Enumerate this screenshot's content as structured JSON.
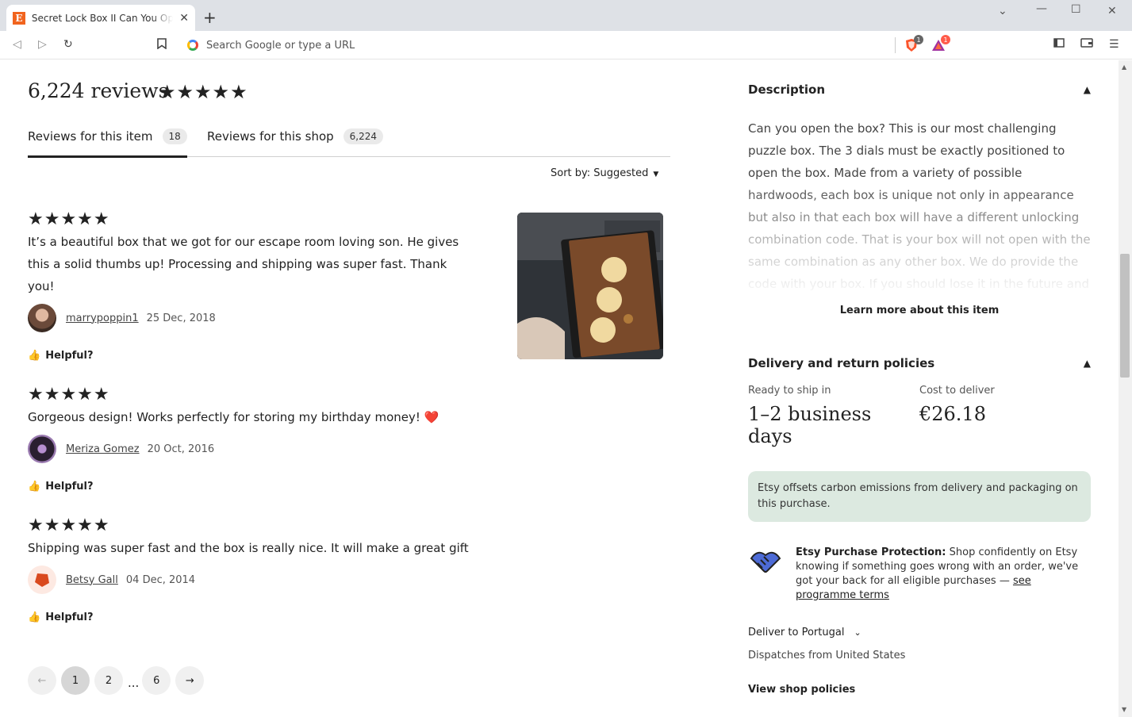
{
  "browser": {
    "tab_title": "Secret Lock Box II Can You Open the Box?",
    "tab_favicon": "E",
    "new_tab": "+",
    "omnibox_placeholder": "Search Google or type a URL",
    "ext_brave_badge": "1",
    "ext_rewards_badge": "1"
  },
  "reviews": {
    "heading": "6,224 reviews",
    "heading_stars": "★★★★★",
    "tabs": [
      {
        "label": "Reviews for this item",
        "count": "18"
      },
      {
        "label": "Reviews for this shop",
        "count": "6,224"
      }
    ],
    "sort_label": "Sort by: Suggested",
    "helpful_label": "Helpful?",
    "items": [
      {
        "stars": "★★★★★",
        "text": "It’s a beautiful box that we got for our escape room loving son. He gives this a solid thumbs up! Processing and shipping was super fast. Thank you!",
        "reviewer": "marrypoppin1",
        "date": "25 Dec, 2018"
      },
      {
        "stars": "★★★★★",
        "text": "Gorgeous design! Works perfectly for storing my birthday money! ❤️",
        "reviewer": "Meriza Gomez",
        "date": "20 Oct, 2016"
      },
      {
        "stars": "★★★★★",
        "text": "Shipping was super fast and the box is really nice. It will make a great gift",
        "reviewer": "Betsy Gall",
        "date": "04 Dec, 2014"
      }
    ],
    "pagination": {
      "prev": "←",
      "pages": [
        "1",
        "2",
        "6"
      ],
      "ellipsis": "...",
      "next": "→",
      "current": "1"
    }
  },
  "description": {
    "title": "Description",
    "text": "Can you open the box? This is our most challenging puzzle box. The 3 dials must be exactly positioned to open the box. Made from a variety of possible hardwoods, each box is unique not only in appearance but also in that each box will have a different unlocking combination code. That is your box will not open with the same combination as any other box. We do provide the code with your box. If you should lose it in the future and you are unable to open the box, just message us, we",
    "learn_more": "Learn more about this item"
  },
  "delivery": {
    "title": "Delivery and return policies",
    "ready_label": "Ready to ship in",
    "ready_value": "1–2 business days",
    "cost_label": "Cost to deliver",
    "cost_value": "€26.18",
    "carbon_note": "Etsy offsets carbon emissions from delivery and packaging on this purchase.",
    "protection_title": "Etsy Purchase Protection:",
    "protection_text": " Shop confidently on Etsy knowing if something goes wrong with an order, we've got your back for all eligible purchases — ",
    "protection_link": "see programme terms",
    "deliver_to": "Deliver to Portugal",
    "dispatches_from": "Dispatches from United States",
    "view_policies": "View shop policies"
  },
  "colors": {
    "etsy_orange": "#f1641e",
    "carbon_bg": "#dce9e0",
    "text_dark": "#222222"
  }
}
